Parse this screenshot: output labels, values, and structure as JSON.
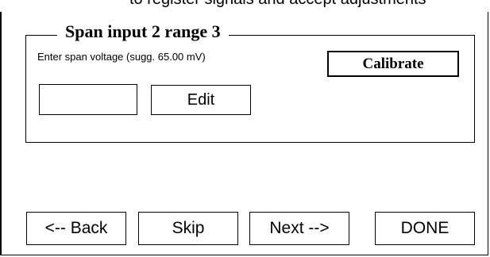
{
  "dialog": {
    "cut_off_text": "to register signals and accept adjustments"
  },
  "group": {
    "title": "Span input 2 range 3",
    "prompt": "Enter span voltage (sugg. 65.00 mV)",
    "calibrate_label": "Calibrate",
    "voltage_value": "",
    "edit_label": "Edit"
  },
  "nav": {
    "back_label": "<-- Back",
    "skip_label": "Skip",
    "next_label": "Next -->",
    "done_label": "DONE"
  }
}
